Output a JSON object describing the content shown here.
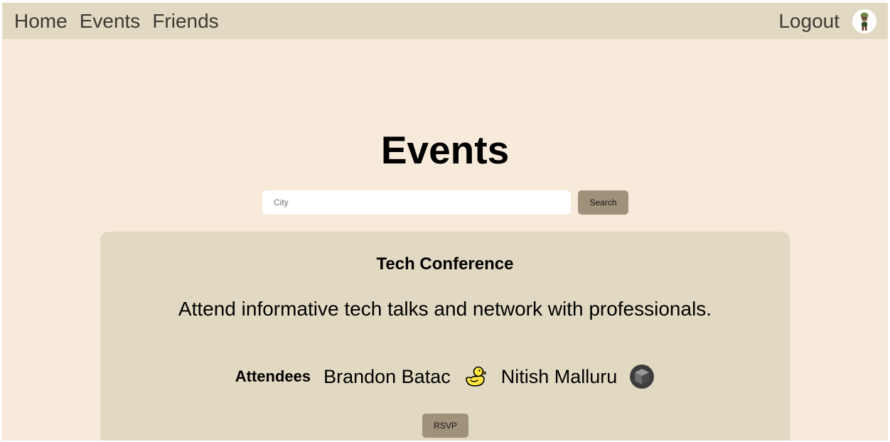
{
  "nav": {
    "links": [
      {
        "label": "Home"
      },
      {
        "label": "Events"
      },
      {
        "label": "Friends"
      }
    ],
    "logout_label": "Logout",
    "avatar_icon": "user-avatar-icon"
  },
  "page": {
    "title": "Events"
  },
  "search": {
    "placeholder": "City",
    "value": "",
    "button_label": "Search"
  },
  "event": {
    "title": "Tech Conference",
    "description": "Attend informative tech talks and network with professionals.",
    "attendees_label": "Attendees",
    "attendees": [
      {
        "name": "Brandon Batac",
        "icon": "duck-icon"
      },
      {
        "name": "Nitish Malluru",
        "icon": "cube-icon"
      }
    ],
    "rsvp_label": "RSVP"
  },
  "colors": {
    "page_background": "#f7eadb",
    "navbar_background": "#e1d9c2",
    "card_background": "#e1d9c2",
    "button_background": "#a0917a"
  }
}
